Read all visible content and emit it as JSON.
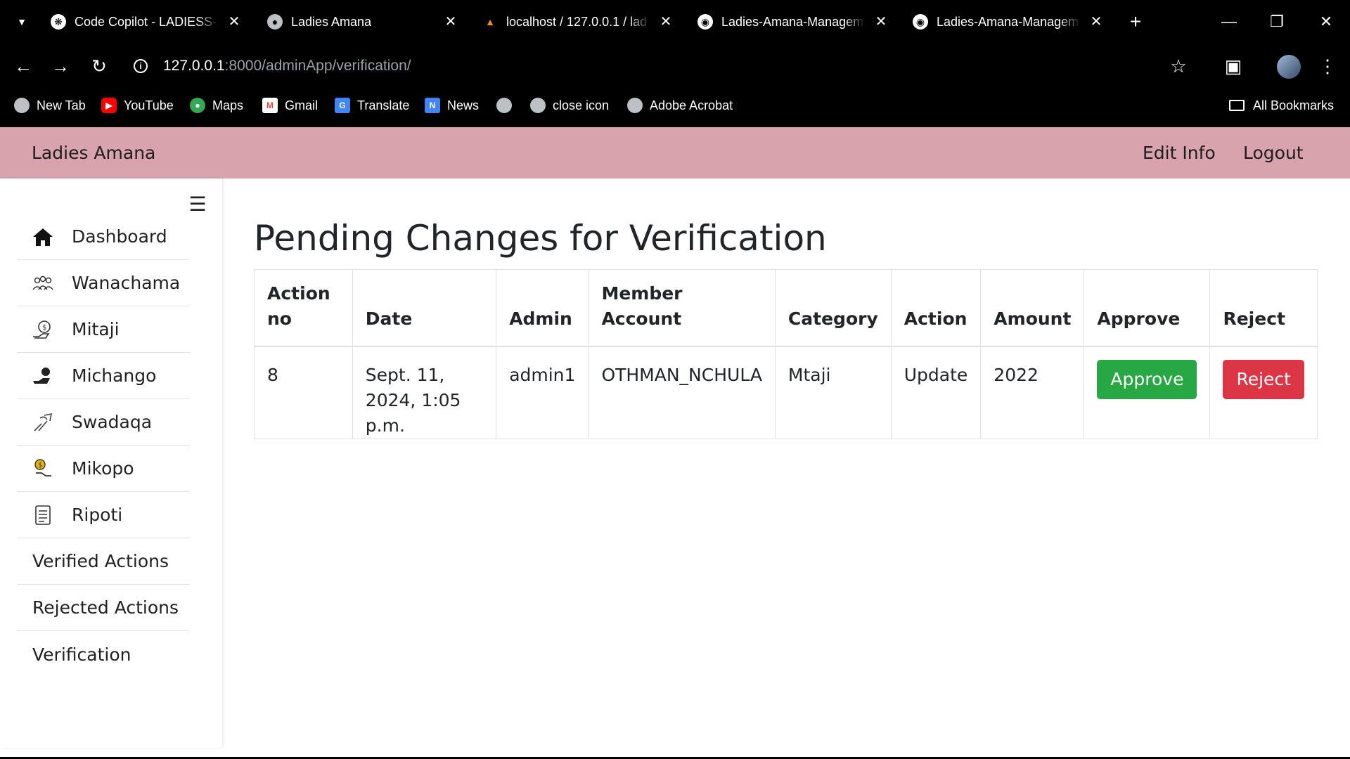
{
  "browser": {
    "tabs": [
      {
        "title": "Code Copilot - LADIESS-S",
        "icon": "copilot-icon"
      },
      {
        "title": "Ladies Amana",
        "icon": "globe-icon"
      },
      {
        "title": "localhost / 127.0.0.1 / lad",
        "icon": "phpmyadmin-icon"
      },
      {
        "title": "Ladies-Amana-Managem",
        "icon": "github-icon"
      },
      {
        "title": "Ladies-Amana-Managem",
        "icon": "github-icon"
      }
    ],
    "url_host": "127.0.0.1",
    "url_path": ":8000/adminApp/verification/",
    "bookmarks": [
      {
        "label": "New Tab"
      },
      {
        "label": "YouTube"
      },
      {
        "label": "Maps"
      },
      {
        "label": "Gmail"
      },
      {
        "label": "Translate"
      },
      {
        "label": "News"
      },
      {
        "label": ""
      },
      {
        "label": "close icon"
      },
      {
        "label": "Adobe Acrobat"
      }
    ],
    "all_bookmarks": "All Bookmarks"
  },
  "navbar": {
    "brand": "Ladies Amana",
    "edit_info": "Edit Info",
    "logout": "Logout",
    "color": "#d8a3ad"
  },
  "sidebar": {
    "items": [
      {
        "label": "Dashboard",
        "icon": "home-icon"
      },
      {
        "label": "Wanachama",
        "icon": "members-icon"
      },
      {
        "label": "Mitaji",
        "icon": "capital-icon"
      },
      {
        "label": "Michango",
        "icon": "contributions-icon"
      },
      {
        "label": "Swadaqa",
        "icon": "charity-icon"
      },
      {
        "label": "Mikopo",
        "icon": "loans-icon"
      },
      {
        "label": "Ripoti",
        "icon": "report-icon"
      },
      {
        "label": "Verified Actions"
      },
      {
        "label": "Rejected Actions"
      },
      {
        "label": "Verification"
      }
    ]
  },
  "main": {
    "title": "Pending Changes for Verification",
    "table": {
      "headers": [
        "Action no",
        "Date",
        "Admin",
        "Member Account",
        "Category",
        "Action",
        "Amount",
        "Approve",
        "Reject"
      ],
      "rows": [
        {
          "action_no": "8",
          "date": "Sept. 11, 2024, 1:05 p.m.",
          "admin": "admin1",
          "member_account": "OTHMAN_NCHULA",
          "category": "Mtaji",
          "action": "Update",
          "amount": "2022",
          "approve_label": "Approve",
          "reject_label": "Reject"
        }
      ]
    },
    "colors": {
      "approve": "#28a745",
      "reject": "#dc3545"
    }
  }
}
